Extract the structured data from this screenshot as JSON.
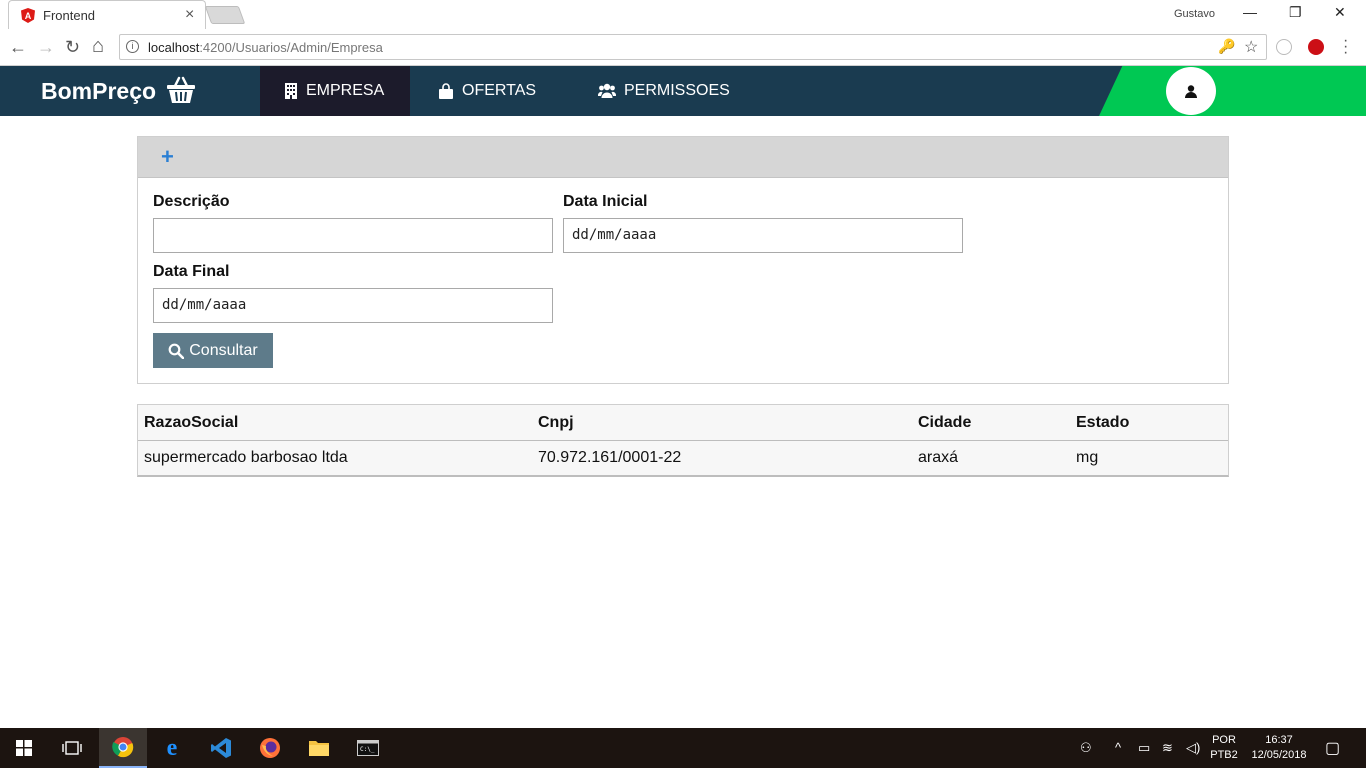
{
  "browser": {
    "tab_title": "Frontend",
    "tab_close": "×",
    "profile_name": "Gustavo",
    "url_host": "localhost",
    "url_path": ":4200/Usuarios/Admin/Empresa",
    "info_icon": "i",
    "key_icon": "🔑",
    "star_icon": "☆",
    "back": "←",
    "forward": "→",
    "reload": "↻",
    "home": "⌂",
    "minimize": "—",
    "restore": "❐",
    "close": "✕"
  },
  "navbar": {
    "brand": "BomPreço",
    "items": [
      {
        "label": "EMPRESA",
        "icon": "building-icon",
        "active": true
      },
      {
        "label": "OFERTAS",
        "icon": "shopping-bag-icon",
        "active": false
      },
      {
        "label": "PERMISSOES",
        "icon": "users-icon",
        "active": false
      }
    ],
    "accent_color": "#00c853",
    "bg_color": "#1a3b50"
  },
  "filter": {
    "add_icon": "+",
    "descricao_label": "Descrição",
    "descricao_value": "",
    "data_inicial_label": "Data Inicial",
    "data_inicial_placeholder": "dd/mm/aaaa",
    "data_final_label": "Data Final",
    "data_final_placeholder": "dd/mm/aaaa",
    "consultar_label": "Consultar"
  },
  "table": {
    "columns": [
      "RazaoSocial",
      "Cnpj",
      "Cidade",
      "Estado"
    ],
    "rows": [
      [
        "supermercado barbosao ltda",
        "70.972.161/0001-22",
        "araxá",
        "mg"
      ]
    ]
  },
  "taskbar": {
    "lang_top": "POR",
    "lang_bottom": "PTB2",
    "time": "16:37",
    "date": "12/05/2018"
  }
}
